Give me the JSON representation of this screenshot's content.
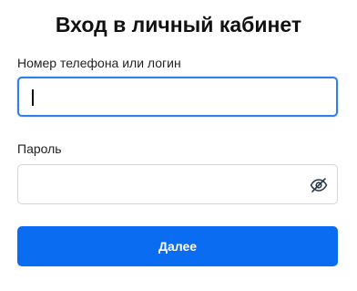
{
  "form": {
    "title": "Вход в личный кабинет",
    "login": {
      "label": "Номер телефона или логин",
      "value": "",
      "placeholder": ""
    },
    "password": {
      "label": "Пароль",
      "value": "",
      "placeholder": "",
      "visibility_icon": "eye-slash-icon"
    },
    "submit_label": "Далее"
  },
  "colors": {
    "accent": "#0a6cf0",
    "focus_border": "#2f80ed",
    "border": "#d5d5d5",
    "text": "#111111",
    "icon": "#2b3a4a"
  }
}
